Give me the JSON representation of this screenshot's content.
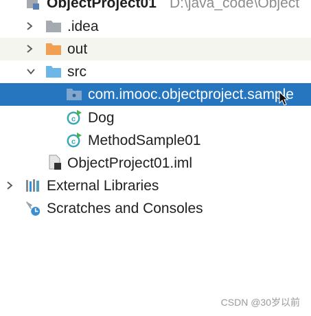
{
  "tree": {
    "root": {
      "name": "ObjectProject01",
      "path": "D:\\java_code\\Object"
    },
    "idea": {
      "label": ".idea"
    },
    "out": {
      "label": "out"
    },
    "src": {
      "label": "src"
    },
    "package": {
      "label": "com.imooc.objectproject.sample"
    },
    "dog": {
      "label": "Dog"
    },
    "method_sample": {
      "label": "MethodSample01"
    },
    "iml": {
      "label": "ObjectProject01.iml"
    },
    "external_libraries": {
      "label": "External Libraries"
    },
    "scratches": {
      "label": "Scratches and Consoles"
    }
  },
  "watermark": "CSDN @30岁以前",
  "colors": {
    "selection": "#2675bf",
    "folder_gray": "#a5a9b0",
    "folder_orange": "#f0a050",
    "folder_blue": "#6cb6e8",
    "class_teal": "#3ba6b8",
    "run_green": "#4cb050"
  }
}
